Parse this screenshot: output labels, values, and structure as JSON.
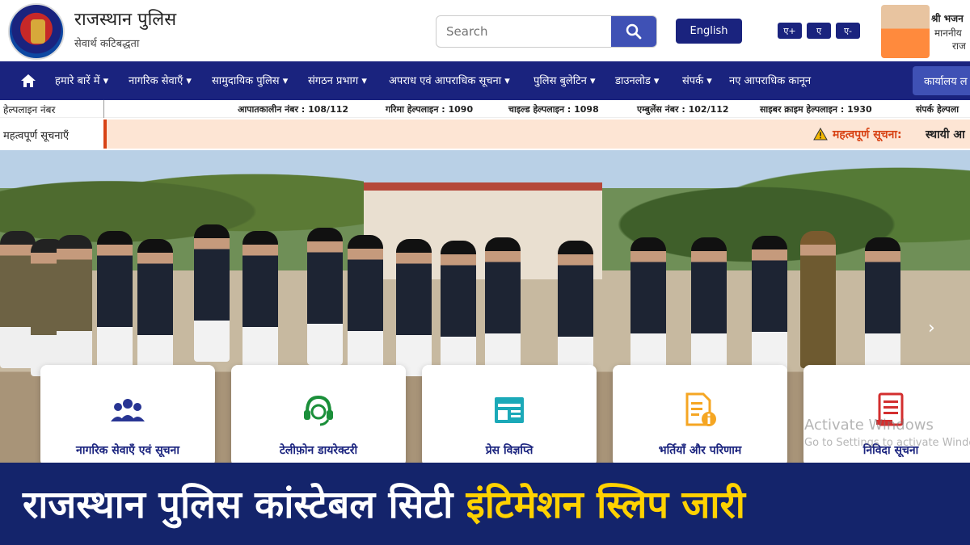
{
  "header": {
    "title": "राजस्थान पुलिस",
    "subtitle": "सेवार्थ कटिबद्धता",
    "search_placeholder": "Search",
    "language_button": "English",
    "font_sizes": [
      "ए+",
      "ए",
      "ए-"
    ],
    "cm_name": "श्री भजन",
    "cm_role": "माननीय",
    "cm_state": "राज"
  },
  "nav": {
    "items": [
      "हमारे बारें में ▾",
      "नागरिक सेवाएँ ▾",
      "सामुदायिक पुलिस ▾",
      "संगठन प्रभाग ▾",
      "अपराध एवं आपराधिक सूचना ▾",
      "पुलिस बुलेटिन ▾",
      "डाउनलोड ▾",
      "संपर्क ▾",
      "नए आपराधिक कानून"
    ],
    "office_button": "कार्यालय ल"
  },
  "helpline": {
    "label": "हेल्पलाइन नंबर",
    "items": [
      "आपातकालीन नंबर : 108/112",
      "गरिमा हेल्पलाइन : 1090",
      "चाइल्ड हेल्पलाइन : 1098",
      "एम्बुलेंस नंबर : 102/112",
      "साइबर क्राइम हेल्पलाइन : 1930",
      "संपर्क हेल्पला"
    ]
  },
  "notice": {
    "label": "महत्वपूर्ण सूचनाएँ",
    "title": "महत्वपूर्ण सूचना:",
    "text": "स्थायी आ"
  },
  "hero": {
    "next_arrow": "›"
  },
  "cards": [
    {
      "label": "नागरिक सेवाएँ एवं सूचना",
      "icon": "people-group-icon",
      "color": "#283593"
    },
    {
      "label": "टेलीफ़ोन डायरेक्टरी",
      "icon": "headset-icon",
      "color": "#1b8f3a"
    },
    {
      "label": "प्रेस विज्ञप्ति",
      "icon": "newspaper-icon",
      "color": "#1ba9b8"
    },
    {
      "label": "भर्तियाँ और परिणाम",
      "icon": "document-info-icon",
      "color": "#f5a623"
    },
    {
      "label": "निविदा सूचना",
      "icon": "tender-document-icon",
      "color": "#d32f2f"
    }
  ],
  "watermark": {
    "line1": "Activate Windows",
    "line2": "Go to Settings to activate Windo"
  },
  "banner": {
    "white_text": "राजस्थान पुलिस कांस्टेबल सिटी",
    "yellow_text": "इंटिमेशन स्लिप जारी"
  },
  "colors": {
    "nav_bg": "#1a237e",
    "banner_bg": "#14246b",
    "banner_accent": "#ffd200",
    "notice_bg": "#fde5d4"
  }
}
